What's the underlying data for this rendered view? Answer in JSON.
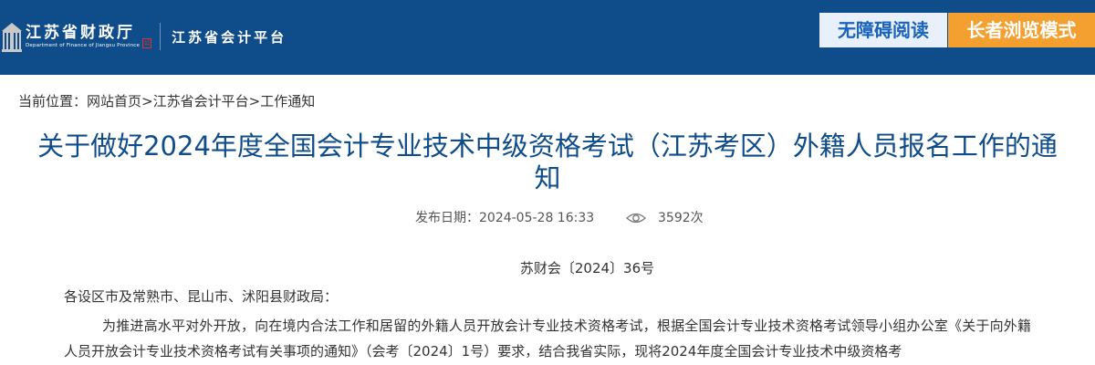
{
  "header": {
    "logo_cn": "江苏省财政厅",
    "logo_en": "Department of Finance of Jiangsu Province",
    "seal": "公",
    "platform": "江苏省会计平台",
    "accessible_label": "无障碍阅读",
    "elder_label": "长者浏览模式",
    "colors": {
      "header_bg": "#0f4c8a",
      "accessible_bg": "#e8f1fb",
      "elder_bg": "#f3a030"
    }
  },
  "breadcrumb": {
    "prefix": "当前位置：",
    "items": [
      "网站首页",
      "江苏省会计平台",
      "工作通知"
    ],
    "separator": ">"
  },
  "article": {
    "title": "关于做好2024年度全国会计专业技术中级资格考试（江苏考区）外籍人员报名工作的通知",
    "publish_label": "发布日期：",
    "publish_date": "2024-05-28  16:33",
    "views": "3592次",
    "doc_number": "苏财会〔2024〕36号",
    "salutation": "各设区市及常熟市、昆山市、沭阳县财政局：",
    "paragraph": "为推进高水平对外开放，向在境内合法工作和居留的外籍人员开放会计专业技术资格考试，根据全国会计专业技术资格考试领导小组办公室《关于向外籍人员开放会计专业技术资格考试有关事项的通知》（会考〔2024〕1号）要求，结合我省实际，现将2024年度全国会计专业技术中级资格考"
  }
}
